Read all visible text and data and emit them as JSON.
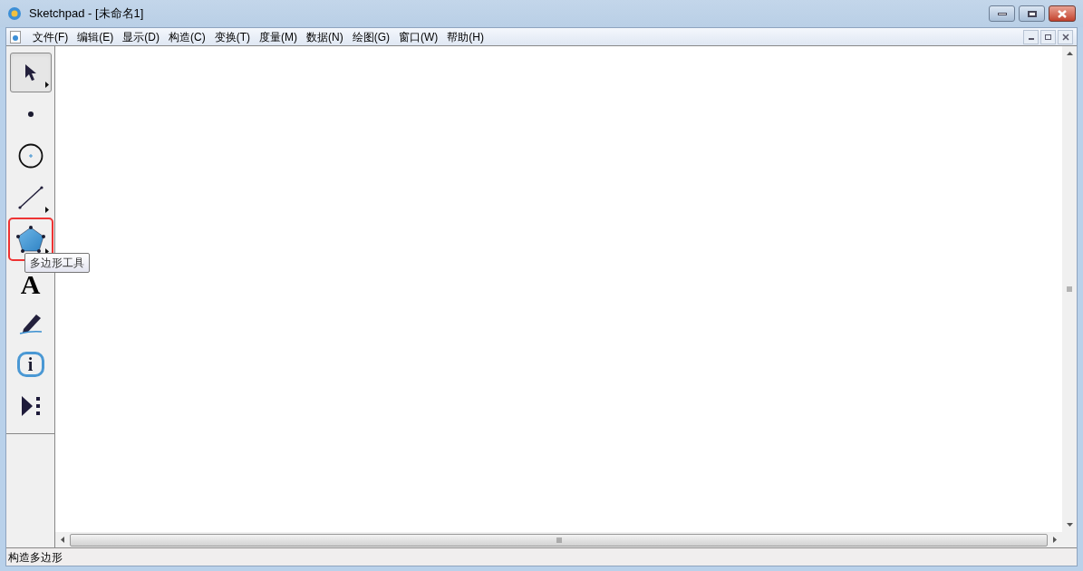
{
  "window": {
    "title": "Sketchpad  - [未命名1]"
  },
  "menu": [
    "文件(F)",
    "编辑(E)",
    "显示(D)",
    "构造(C)",
    "变换(T)",
    "度量(M)",
    "数据(N)",
    "绘图(G)",
    "窗口(W)",
    "帮助(H)"
  ],
  "tools": [
    {
      "kind": "arrow",
      "selected": true,
      "highlighted": false,
      "submenu": true
    },
    {
      "kind": "point",
      "selected": false,
      "highlighted": false,
      "submenu": false
    },
    {
      "kind": "compass",
      "selected": false,
      "highlighted": false,
      "submenu": false
    },
    {
      "kind": "line",
      "selected": false,
      "highlighted": false,
      "submenu": true
    },
    {
      "kind": "polygon",
      "selected": false,
      "highlighted": true,
      "submenu": true
    },
    {
      "kind": "text",
      "selected": false,
      "highlighted": false,
      "submenu": false,
      "glyph": "A"
    },
    {
      "kind": "marker",
      "selected": false,
      "highlighted": false,
      "submenu": false
    },
    {
      "kind": "info",
      "selected": false,
      "highlighted": false,
      "submenu": false,
      "glyph": "i"
    },
    {
      "kind": "custom",
      "selected": false,
      "highlighted": false,
      "submenu": false
    }
  ],
  "tooltip": "多边形工具",
  "status_bar": "构造多边形"
}
